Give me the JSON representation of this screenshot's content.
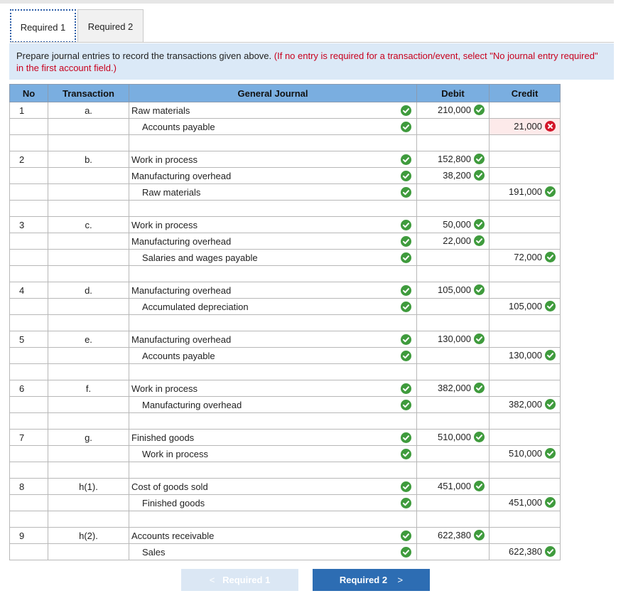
{
  "tabs": [
    {
      "label": "Required 1",
      "active": true
    },
    {
      "label": "Required 2",
      "active": false
    }
  ],
  "instructions": {
    "text": "Prepare journal entries to record the transactions given above.",
    "hint": "(If no entry is required for a transaction/event, select \"No journal entry required\" in the first account field.)"
  },
  "table": {
    "headers": {
      "no": "No",
      "transaction": "Transaction",
      "journal": "General Journal",
      "debit": "Debit",
      "credit": "Credit"
    }
  },
  "rows": [
    {
      "no": "1",
      "trans": "a.",
      "account": "Raw materials",
      "indent": false,
      "debit": "210,000",
      "credit": "",
      "acct_mark": "check",
      "amt_mark": "check"
    },
    {
      "no": "",
      "trans": "",
      "account": "Accounts payable",
      "indent": true,
      "debit": "",
      "credit": "21,000",
      "acct_mark": "check",
      "amt_mark": "cross"
    },
    {
      "no": "",
      "trans": "",
      "account": "",
      "indent": false,
      "debit": "",
      "credit": "",
      "acct_mark": "",
      "amt_mark": ""
    },
    {
      "no": "2",
      "trans": "b.",
      "account": "Work in process",
      "indent": false,
      "debit": "152,800",
      "credit": "",
      "acct_mark": "check",
      "amt_mark": "check"
    },
    {
      "no": "",
      "trans": "",
      "account": "Manufacturing overhead",
      "indent": false,
      "debit": "38,200",
      "credit": "",
      "acct_mark": "check",
      "amt_mark": "check"
    },
    {
      "no": "",
      "trans": "",
      "account": "Raw materials",
      "indent": true,
      "debit": "",
      "credit": "191,000",
      "acct_mark": "check",
      "amt_mark": "check"
    },
    {
      "no": "",
      "trans": "",
      "account": "",
      "indent": false,
      "debit": "",
      "credit": "",
      "acct_mark": "",
      "amt_mark": ""
    },
    {
      "no": "3",
      "trans": "c.",
      "account": "Work in process",
      "indent": false,
      "debit": "50,000",
      "credit": "",
      "acct_mark": "check",
      "amt_mark": "check"
    },
    {
      "no": "",
      "trans": "",
      "account": "Manufacturing overhead",
      "indent": false,
      "debit": "22,000",
      "credit": "",
      "acct_mark": "check",
      "amt_mark": "check"
    },
    {
      "no": "",
      "trans": "",
      "account": "Salaries and wages payable",
      "indent": true,
      "debit": "",
      "credit": "72,000",
      "acct_mark": "check",
      "amt_mark": "check"
    },
    {
      "no": "",
      "trans": "",
      "account": "",
      "indent": false,
      "debit": "",
      "credit": "",
      "acct_mark": "",
      "amt_mark": ""
    },
    {
      "no": "4",
      "trans": "d.",
      "account": "Manufacturing overhead",
      "indent": false,
      "debit": "105,000",
      "credit": "",
      "acct_mark": "check",
      "amt_mark": "check"
    },
    {
      "no": "",
      "trans": "",
      "account": "Accumulated depreciation",
      "indent": true,
      "debit": "",
      "credit": "105,000",
      "acct_mark": "check",
      "amt_mark": "check"
    },
    {
      "no": "",
      "trans": "",
      "account": "",
      "indent": false,
      "debit": "",
      "credit": "",
      "acct_mark": "",
      "amt_mark": ""
    },
    {
      "no": "5",
      "trans": "e.",
      "account": "Manufacturing overhead",
      "indent": false,
      "debit": "130,000",
      "credit": "",
      "acct_mark": "check",
      "amt_mark": "check"
    },
    {
      "no": "",
      "trans": "",
      "account": "Accounts payable",
      "indent": true,
      "debit": "",
      "credit": "130,000",
      "acct_mark": "check",
      "amt_mark": "check"
    },
    {
      "no": "",
      "trans": "",
      "account": "",
      "indent": false,
      "debit": "",
      "credit": "",
      "acct_mark": "",
      "amt_mark": ""
    },
    {
      "no": "6",
      "trans": "f.",
      "account": "Work in process",
      "indent": false,
      "debit": "382,000",
      "credit": "",
      "acct_mark": "check",
      "amt_mark": "check"
    },
    {
      "no": "",
      "trans": "",
      "account": "Manufacturing overhead",
      "indent": true,
      "debit": "",
      "credit": "382,000",
      "acct_mark": "check",
      "amt_mark": "check"
    },
    {
      "no": "",
      "trans": "",
      "account": "",
      "indent": false,
      "debit": "",
      "credit": "",
      "acct_mark": "",
      "amt_mark": ""
    },
    {
      "no": "7",
      "trans": "g.",
      "account": "Finished goods",
      "indent": false,
      "debit": "510,000",
      "credit": "",
      "acct_mark": "check",
      "amt_mark": "check"
    },
    {
      "no": "",
      "trans": "",
      "account": "Work in process",
      "indent": true,
      "debit": "",
      "credit": "510,000",
      "acct_mark": "check",
      "amt_mark": "check"
    },
    {
      "no": "",
      "trans": "",
      "account": "",
      "indent": false,
      "debit": "",
      "credit": "",
      "acct_mark": "",
      "amt_mark": ""
    },
    {
      "no": "8",
      "trans": "h(1).",
      "account": "Cost of goods sold",
      "indent": false,
      "debit": "451,000",
      "credit": "",
      "acct_mark": "check",
      "amt_mark": "check"
    },
    {
      "no": "",
      "trans": "",
      "account": "Finished goods",
      "indent": true,
      "debit": "",
      "credit": "451,000",
      "acct_mark": "check",
      "amt_mark": "check"
    },
    {
      "no": "",
      "trans": "",
      "account": "",
      "indent": false,
      "debit": "",
      "credit": "",
      "acct_mark": "",
      "amt_mark": ""
    },
    {
      "no": "9",
      "trans": "h(2).",
      "account": "Accounts receivable",
      "indent": false,
      "debit": "622,380",
      "credit": "",
      "acct_mark": "check",
      "amt_mark": "check"
    },
    {
      "no": "",
      "trans": "",
      "account": "Sales",
      "indent": true,
      "debit": "",
      "credit": "622,380",
      "acct_mark": "check",
      "amt_mark": "check"
    }
  ],
  "nav": {
    "prev_label": "Required 1",
    "prev_chevron": "<",
    "next_label": "Required 2",
    "next_chevron": ">"
  },
  "colors": {
    "check": "#3f9b3d",
    "cross": "#d3162a",
    "header": "#7aaee0",
    "instructions_bg": "#dbe9f7",
    "next_button": "#2d6db3"
  }
}
